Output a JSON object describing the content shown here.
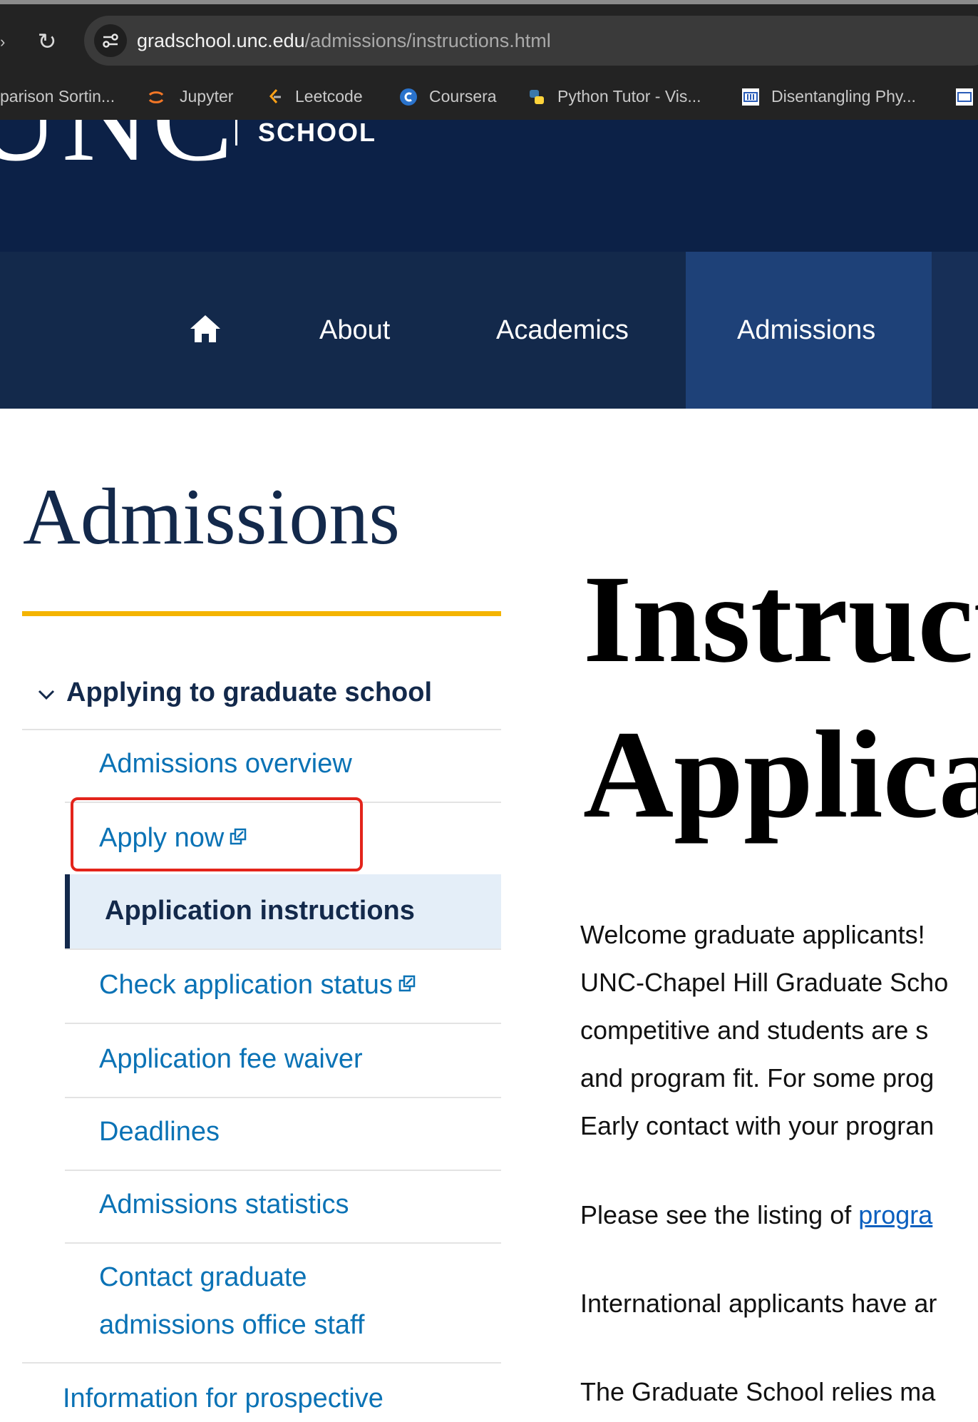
{
  "browser": {
    "url_host": "gradschool.unc.edu",
    "url_path": "/admissions/instructions.html",
    "bookmarks": [
      {
        "label": "parison Sortin...",
        "icon": "bookmark-icon"
      },
      {
        "label": "Jupyter",
        "icon": "jupyter-icon"
      },
      {
        "label": "Leetcode",
        "icon": "leetcode-icon"
      },
      {
        "label": "Coursera",
        "icon": "coursera-icon"
      },
      {
        "label": "Python Tutor - Vis...",
        "icon": "python-icon"
      },
      {
        "label": "Disentangling Phy...",
        "icon": "arxiv-icon"
      }
    ]
  },
  "header": {
    "logo_text": "UNC",
    "logo_school": "SCHOOL"
  },
  "nav": {
    "items": [
      {
        "label": "About"
      },
      {
        "label": "Academics"
      },
      {
        "label": "Admissions",
        "active": true
      }
    ]
  },
  "sidebar": {
    "title": "Admissions",
    "section": "Applying to graduate school",
    "items": [
      {
        "label": "Admissions overview"
      },
      {
        "label": "Apply now",
        "external": true
      },
      {
        "label": "Application instructions",
        "active": true
      },
      {
        "label": "Check application status",
        "external": true
      },
      {
        "label": "Application fee waiver"
      },
      {
        "label": "Deadlines"
      },
      {
        "label": "Admissions statistics"
      },
      {
        "label": "Contact graduate",
        "label2": "admissions office staff"
      }
    ],
    "next_section": "Information for prospective"
  },
  "main": {
    "title_line1": "Instruct",
    "title_line2": "Applica",
    "paragraph1": [
      "Welcome graduate applicants!",
      "UNC-Chapel Hill Graduate Scho",
      "competitive and students are s",
      "and program fit. For some prog",
      "Early contact with your progran"
    ],
    "paragraph2_text": "Please see the listing of ",
    "paragraph2_link": "progra",
    "paragraph3": "International applicants have ar",
    "paragraph4": "The Graduate School relies ma"
  }
}
